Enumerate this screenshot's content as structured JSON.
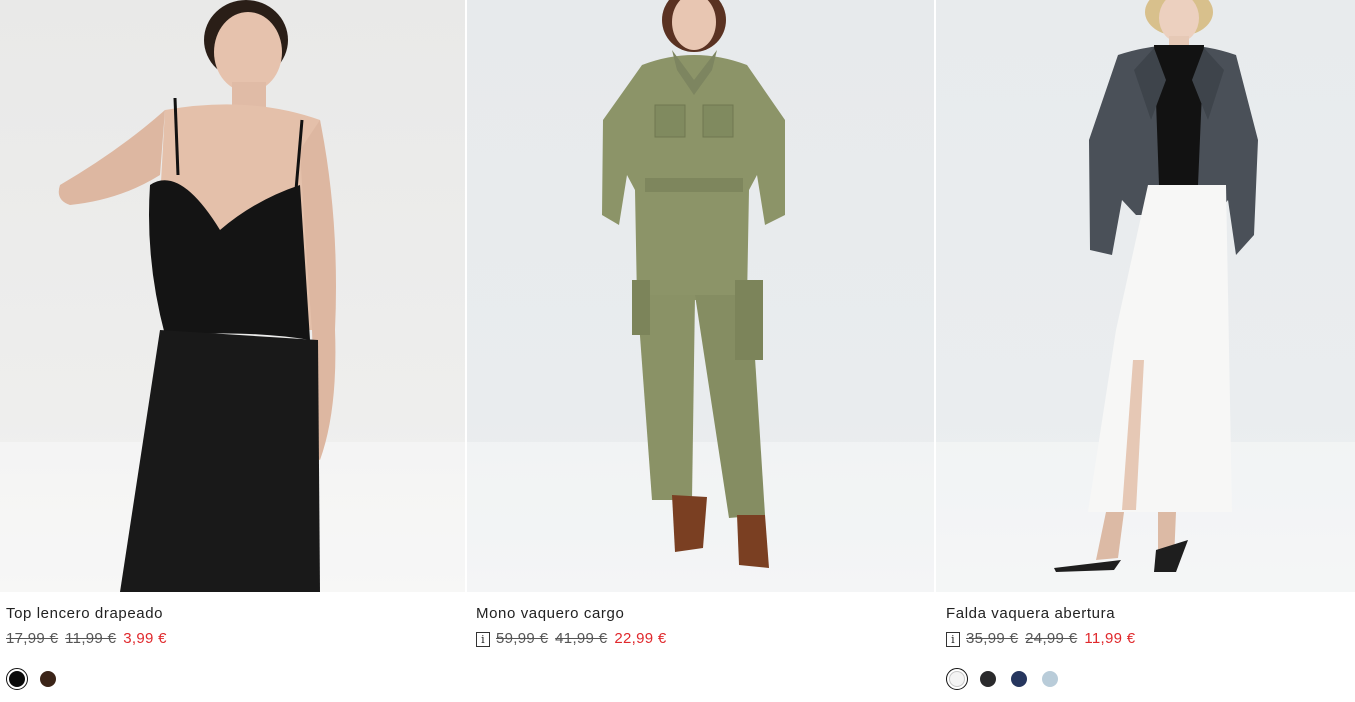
{
  "products": [
    {
      "name": "Top lencero drapeado",
      "old_prices": [
        "17,99 €",
        "11,99 €"
      ],
      "sale_price": "3,99 €",
      "has_info_icon": false,
      "info_icon": "i",
      "swatches": [
        {
          "color": "#0a0a0a",
          "selected": true
        },
        {
          "color": "#3b2418",
          "selected": false
        }
      ]
    },
    {
      "name": "Mono vaquero cargo",
      "old_prices": [
        "59,99 €",
        "41,99 €"
      ],
      "sale_price": "22,99 €",
      "has_info_icon": true,
      "info_icon": "i",
      "swatches": []
    },
    {
      "name": "Falda vaquera abertura",
      "old_prices": [
        "35,99 €",
        "24,99 €"
      ],
      "sale_price": "11,99 €",
      "has_info_icon": true,
      "info_icon": "i",
      "swatches": [
        {
          "color": "#f4f4f4",
          "selected": true
        },
        {
          "color": "#2a2a2c",
          "selected": false
        },
        {
          "color": "#26365e",
          "selected": false
        },
        {
          "color": "#b9ccd9",
          "selected": false
        }
      ]
    }
  ],
  "colors": {
    "sale": "#e0282c",
    "text": "#222222",
    "strike": "#555555"
  }
}
